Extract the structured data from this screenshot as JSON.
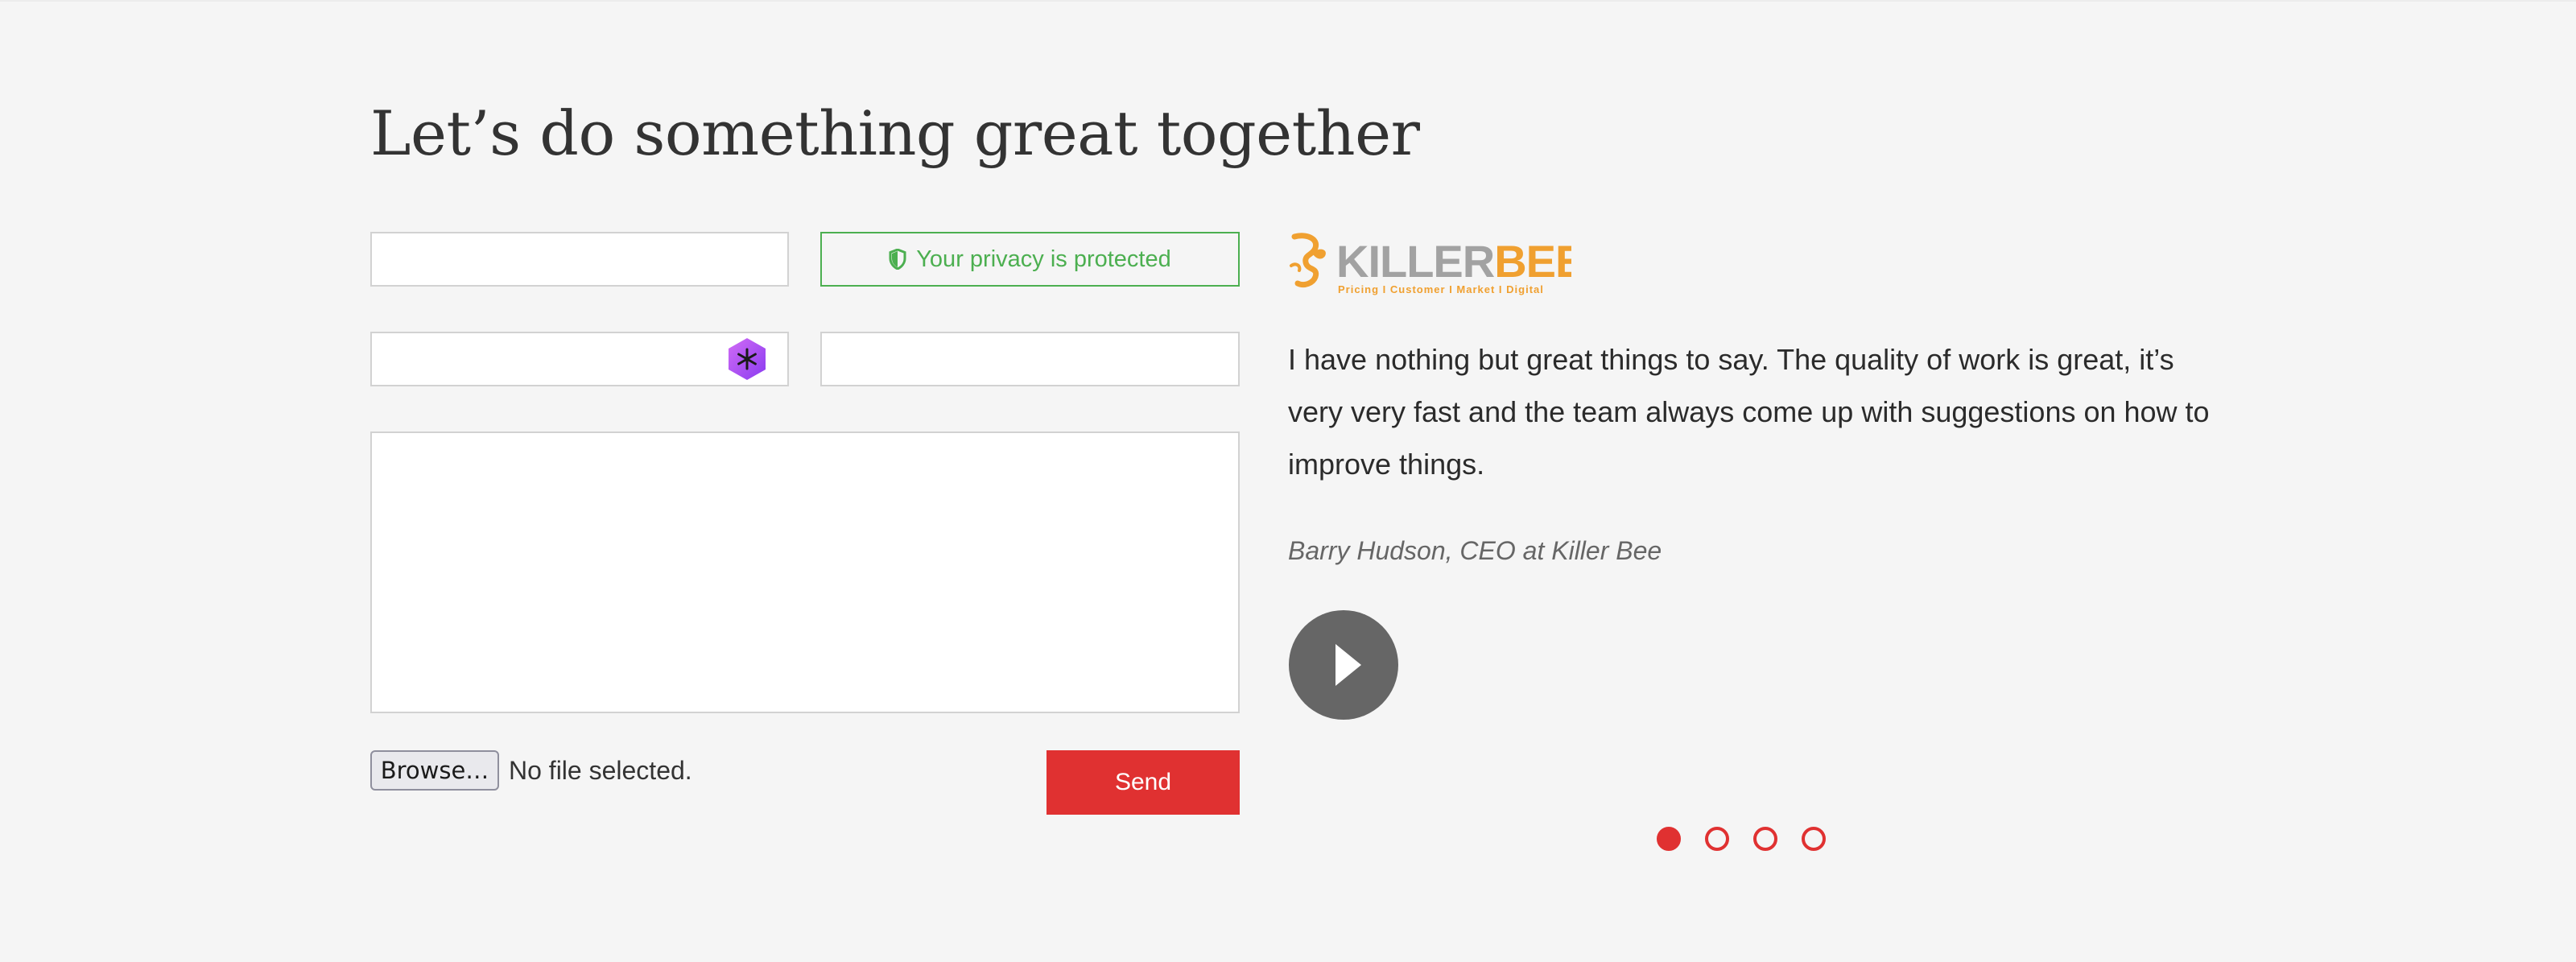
{
  "section": {
    "heading": "Let’s do something great together"
  },
  "form": {
    "name_field": {
      "value": "",
      "placeholder": ""
    },
    "email_field": {
      "value": "",
      "placeholder": ""
    },
    "phone_field": {
      "value": "",
      "placeholder": ""
    },
    "message_field": {
      "value": "",
      "placeholder": ""
    },
    "privacy_notice": "Your privacy is protected",
    "privacy_icon": "shield-icon",
    "extension_icon": "password-manager-icon",
    "browse_label": "Browse…",
    "file_status": "No file selected.",
    "send_label": "Send"
  },
  "testimonial": {
    "logo": {
      "brand_part1": "KILLER",
      "brand_part2": "BEE",
      "tagline": "Pricing I Customer I Market I Digital"
    },
    "quote": "I have nothing but great things to say. The quality of work is great, it’s very very fast and the team always come up with suggestions on how to improve things.",
    "author": "Barry Hudson, CEO at Killer Bee",
    "play_icon": "play-icon"
  },
  "carousel": {
    "slide_count": 4,
    "active_index": 0
  },
  "colors": {
    "accent_red": "#e03131",
    "privacy_green": "#4caf50",
    "background": "#f5f5f5",
    "logo_grey": "#a2a2a2",
    "logo_orange": "#f0a030"
  }
}
